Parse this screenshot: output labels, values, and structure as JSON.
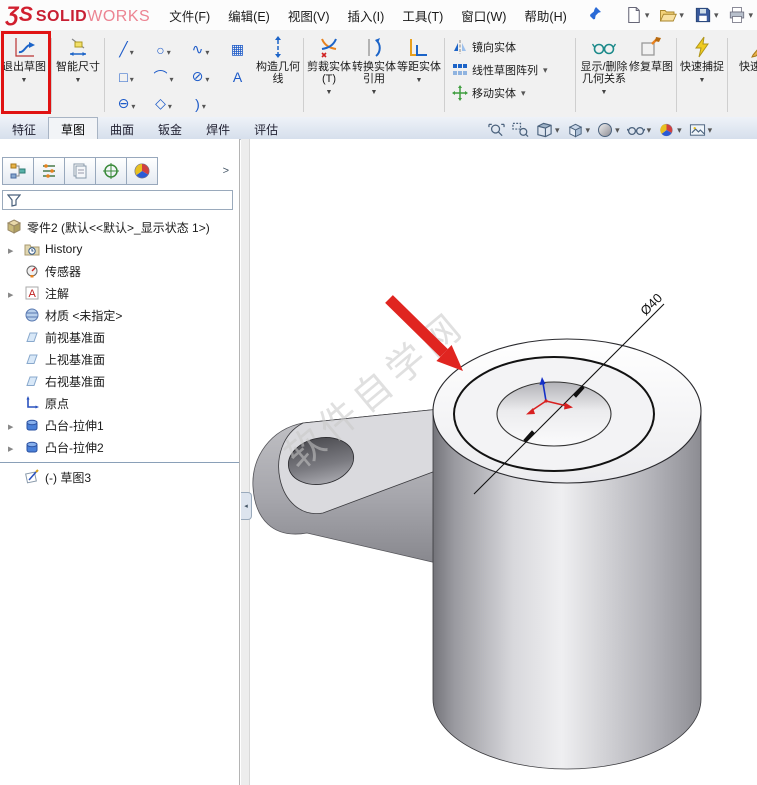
{
  "logo": {
    "ds": "ƷS",
    "solid": "SOLID",
    "works": "WORKS"
  },
  "menubar": {
    "items": [
      "文件(F)",
      "编辑(E)",
      "视图(V)",
      "插入(I)",
      "工具(T)",
      "窗口(W)",
      "帮助(H)"
    ]
  },
  "ribbon": {
    "exit_sketch": "退出草图",
    "smart_dimension": "智能尺寸",
    "sketch_tools": [
      {
        "g": "╱"
      },
      {
        "g": "○"
      },
      {
        "g": "∿"
      },
      {
        "g": "▦"
      },
      {
        "g": "□"
      },
      {
        "g": "⌒"
      },
      {
        "g": "⊘"
      },
      {
        "g": "A"
      },
      {
        "g": "⊖"
      },
      {
        "g": "◇"
      },
      {
        "g": ")"
      }
    ],
    "construction_geometry": "构造几何线",
    "trim_entities": "剪裁实体(T)",
    "convert_entities": "转换实体引用",
    "offset_entities": "等距实体",
    "mirror_entities": "镜向实体",
    "linear_sketch_pattern": "线性草图阵列",
    "move_entities": "移动实体",
    "display_delete_relations": "显示/删除几何关系",
    "repair_sketch": "修复草图",
    "quick_snaps": "快速捕捉",
    "rapid_sketch": "快速草图"
  },
  "tabs": {
    "items": [
      "特征",
      "草图",
      "曲面",
      "钣金",
      "焊件",
      "评估"
    ],
    "active": "草图"
  },
  "feature_tree": {
    "root": "零件2 (默认<<默认>_显示状态 1>)",
    "items": [
      {
        "label": "History"
      },
      {
        "label": "传感器"
      },
      {
        "label": "注解"
      },
      {
        "label": "材质 <未指定>"
      },
      {
        "label": "前视基准面"
      },
      {
        "label": "上视基准面"
      },
      {
        "label": "右视基准面"
      },
      {
        "label": "原点"
      },
      {
        "label": "凸台-拉伸1"
      },
      {
        "label": "凸台-拉伸2"
      },
      {
        "label": "(-) 草图3"
      }
    ]
  },
  "viewport": {
    "dimension_label": "Ø40",
    "watermark": "软件自学网"
  },
  "colors": {
    "annotation_red": "#e01212",
    "arrow_red": "#e02520",
    "brand_red": "#d11f2f",
    "sketch_blue": "#1c5ac8"
  }
}
